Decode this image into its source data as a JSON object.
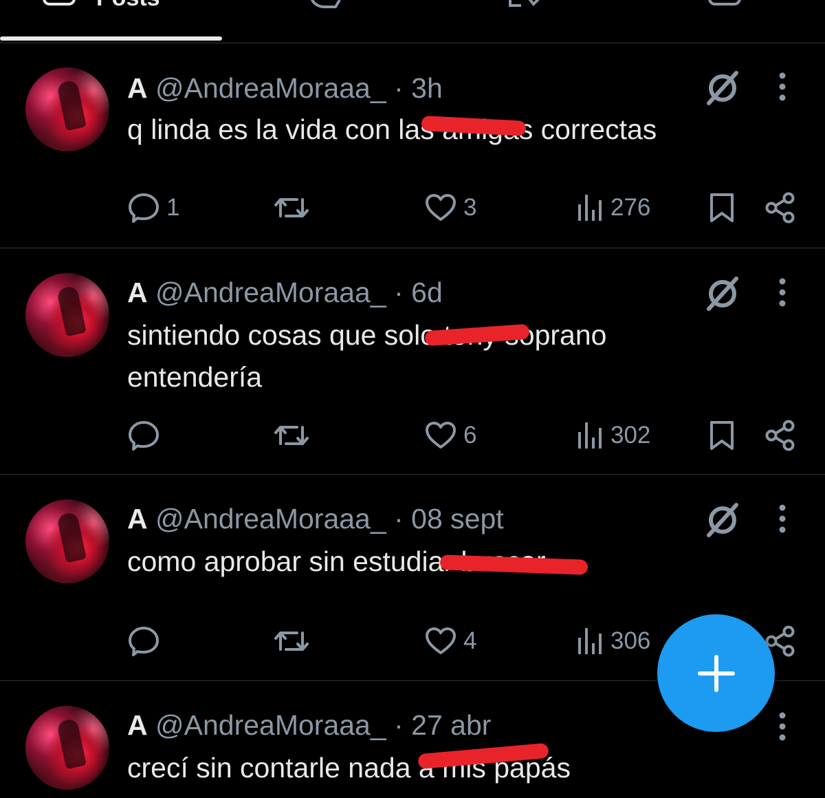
{
  "tabs": {
    "active_label": "Posts"
  },
  "posts": [
    {
      "display_name": "A",
      "handle": "@AndreaMoraaa_",
      "separator": "·",
      "time": "3h",
      "text": "q linda es la vida con las amigas correctas",
      "replies": "1",
      "reposts": "",
      "likes": "3",
      "views": "276"
    },
    {
      "display_name": "A",
      "handle": "@AndreaMoraaa_",
      "separator": "·",
      "time": "6d",
      "text": "sintiendo cosas que solo tony soprano entendería",
      "replies": "",
      "reposts": "",
      "likes": "6",
      "views": "302"
    },
    {
      "display_name": "A",
      "handle": "@AndreaMoraaa_",
      "separator": "·",
      "time": "08 sept",
      "text": "como aprobar sin estudiar buscar",
      "replies": "",
      "reposts": "",
      "likes": "4",
      "views": "306"
    },
    {
      "display_name": "A",
      "handle": "@AndreaMoraaa_",
      "separator": "·",
      "time": "27 abr",
      "text": "crecí sin contarle nada a mis papás",
      "replies": "",
      "reposts": "",
      "likes": "",
      "views": ""
    }
  ],
  "icons": {
    "reply": "speech-bubble-icon",
    "repost": "repost-arrows-icon",
    "like": "heart-icon",
    "views": "bar-chart-icon",
    "bookmark": "bookmark-icon",
    "share": "share-icon",
    "grok": "grok-slash-circle-icon",
    "more": "vertical-ellipsis-icon",
    "compose": "plus-icon"
  },
  "colors": {
    "background": "#000000",
    "text": "#e7e9ea",
    "muted": "#8b98a5",
    "accent": "#1d9bf0",
    "redaction": "#e8242a",
    "divider": "#2f3336"
  }
}
